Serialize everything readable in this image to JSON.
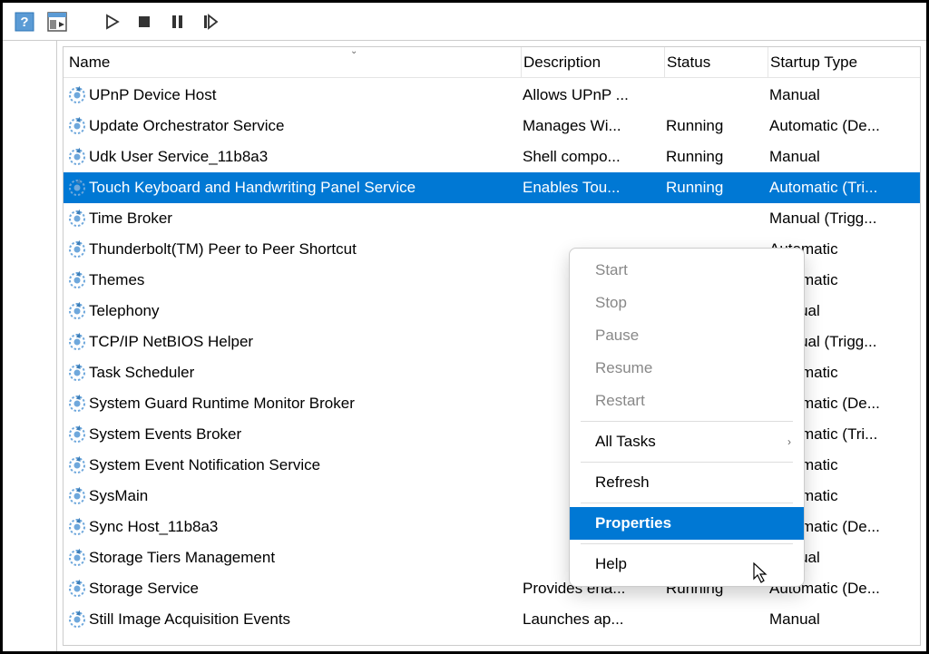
{
  "toolbar": {
    "help": "help-icon",
    "show_hide": "show-hide-panel-icon",
    "play": "play-icon",
    "stop": "stop-icon",
    "pause": "pause-icon",
    "restart": "restart-icon"
  },
  "columns": {
    "name": "Name",
    "description": "Description",
    "status": "Status",
    "startup": "Startup Type"
  },
  "services": [
    {
      "name": "UPnP Device Host",
      "description": "Allows UPnP ...",
      "status": "",
      "startup": "Manual",
      "selected": false
    },
    {
      "name": "Update Orchestrator Service",
      "description": "Manages Wi...",
      "status": "Running",
      "startup": "Automatic (De...",
      "selected": false
    },
    {
      "name": "Udk User Service_11b8a3",
      "description": "Shell compo...",
      "status": "Running",
      "startup": "Manual",
      "selected": false
    },
    {
      "name": "Touch Keyboard and Handwriting Panel Service",
      "description": "Enables Tou...",
      "status": "Running",
      "startup": "Automatic (Tri...",
      "selected": true
    },
    {
      "name": "Time Broker",
      "description": "",
      "status": "",
      "startup": "Manual (Trigg...",
      "selected": false
    },
    {
      "name": "Thunderbolt(TM) Peer to Peer Shortcut",
      "description": "",
      "status": "",
      "startup": "Automatic",
      "selected": false
    },
    {
      "name": "Themes",
      "description": "",
      "status": "",
      "startup": "Automatic",
      "selected": false
    },
    {
      "name": "Telephony",
      "description": "",
      "status": "",
      "startup": "Manual",
      "selected": false
    },
    {
      "name": "TCP/IP NetBIOS Helper",
      "description": "",
      "status": "",
      "startup": "Manual (Trigg...",
      "selected": false
    },
    {
      "name": "Task Scheduler",
      "description": "",
      "status": "",
      "startup": "Automatic",
      "selected": false
    },
    {
      "name": "System Guard Runtime Monitor Broker",
      "description": "",
      "status": "",
      "startup": "Automatic (De...",
      "selected": false
    },
    {
      "name": "System Events Broker",
      "description": "",
      "status": "",
      "startup": "Automatic (Tri...",
      "selected": false
    },
    {
      "name": "System Event Notification Service",
      "description": "",
      "status": "",
      "startup": "Automatic",
      "selected": false
    },
    {
      "name": "SysMain",
      "description": "",
      "status": "",
      "startup": "Automatic",
      "selected": false
    },
    {
      "name": "Sync Host_11b8a3",
      "description": "",
      "status": "",
      "startup": "Automatic (De...",
      "selected": false
    },
    {
      "name": "Storage Tiers Management",
      "description": "",
      "status": "",
      "startup": "Manual",
      "selected": false
    },
    {
      "name": "Storage Service",
      "description": "Provides ena...",
      "status": "Running",
      "startup": "Automatic (De...",
      "selected": false
    },
    {
      "name": "Still Image Acquisition Events",
      "description": "Launches ap...",
      "status": "",
      "startup": "Manual",
      "selected": false
    }
  ],
  "context_menu": {
    "start": "Start",
    "stop": "Stop",
    "pause": "Pause",
    "resume": "Resume",
    "restart": "Restart",
    "all_tasks": "All Tasks",
    "refresh": "Refresh",
    "properties": "Properties",
    "help": "Help"
  }
}
